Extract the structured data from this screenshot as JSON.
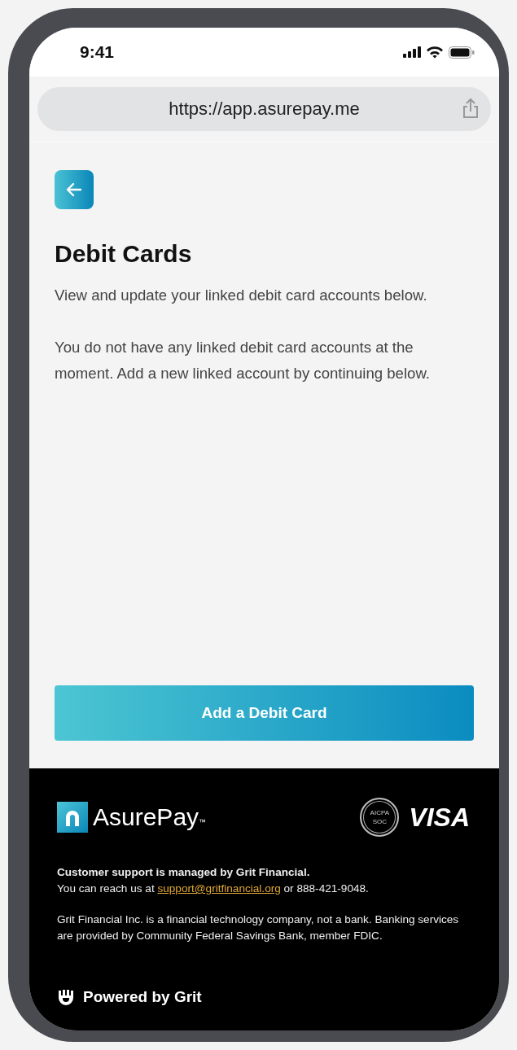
{
  "status_bar": {
    "time": "9:41"
  },
  "browser": {
    "url": "https://app.asurepay.me"
  },
  "page": {
    "title": "Debit Cards",
    "intro": "View and update your linked debit card accounts below.",
    "empty_message": "You do not have any linked debit card accounts at the moment. Add a new linked account by continuing below."
  },
  "primary_button": "Add a Debit Card",
  "footer": {
    "brand": {
      "name": "AsurePay",
      "trademark": "™"
    },
    "badge": {
      "line_1": "AICPA",
      "line_2": "SOC"
    },
    "card_network": "VISA",
    "support_heading": "Customer support is managed by Grit Financial.",
    "contact": {
      "before": "You can reach us at",
      "email": "support@gritfinancial.org",
      "after": "or 888-421-9048."
    },
    "disclaimer": "Grit Financial Inc. is a financial technology company, not a bank. Banking services are provided by Community Federal Savings Bank, member FDIC.",
    "powered_by": "Powered by Grit"
  }
}
